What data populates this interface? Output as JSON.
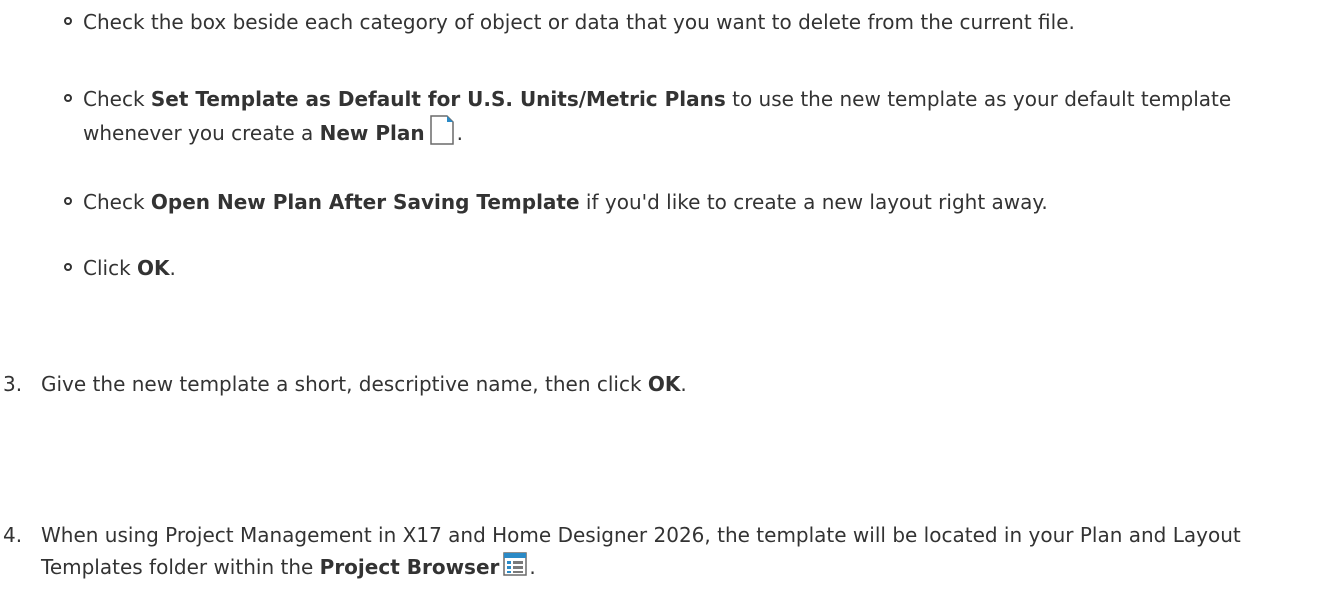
{
  "sub_items": [
    {
      "t1": "Check the box beside each category of object or data that you want to delete from the current file."
    },
    {
      "t1": "Check ",
      "b1": "Set Template as Default for U.S. Units/Metric Plans",
      "t2": " to use the new template as your default template whenever you create a ",
      "b2": "New Plan",
      "t3": ".",
      "icon": "new-plan-icon"
    },
    {
      "t1": "Check ",
      "b1": "Open New Plan After Saving Template",
      "t2": " if you'd like to create a new layout right away."
    },
    {
      "t1": "Click ",
      "b1": "OK",
      "t2": "."
    }
  ],
  "steps": [
    {
      "number": "3.",
      "t1": "Give the new template a short, descriptive name, then click ",
      "b1": "OK",
      "t2": "."
    },
    {
      "number": "4.",
      "t1": "When using Project Management in X17 and Home Designer 2026, the template will be located in your Plan and Layout Templates folder within the ",
      "b1": "Project Browser",
      "t2": ".",
      "icon": "project-browser-icon"
    }
  ],
  "colors": {
    "text": "#333333",
    "icon_blue": "#2b8ac6"
  }
}
